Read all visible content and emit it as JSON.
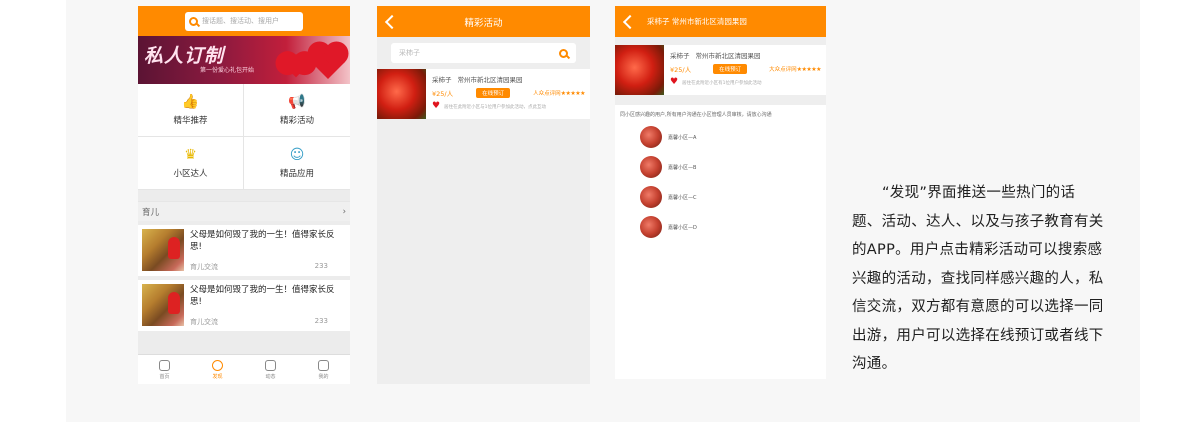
{
  "phone1": {
    "search_placeholder": "搜话题、搜活动、搜用户",
    "banner_title": "私人订制",
    "banner_subtitle": "第一份爱心礼包开始",
    "grid": [
      {
        "label": "精华推荐",
        "icon": "thumbs-up-icon",
        "glyph": "👍",
        "color": "#e0506a"
      },
      {
        "label": "精彩活动",
        "icon": "megaphone-icon",
        "glyph": "📢",
        "color": "#3aa98a"
      },
      {
        "label": "小区达人",
        "icon": "crown-icon",
        "glyph": "♛",
        "color": "#e8b800"
      },
      {
        "label": "精品应用",
        "icon": "app-face-icon",
        "glyph": "☺",
        "color": "#3aa0c8"
      }
    ],
    "section_title": "育儿",
    "posts": [
      {
        "title": "父母是如何毁了我的一生！值得家长反思!",
        "tag": "育儿交流",
        "count": "233"
      },
      {
        "title": "父母是如何毁了我的一生！值得家长反思!",
        "tag": "育儿交流",
        "count": "233"
      }
    ],
    "tabs": [
      {
        "label": "首页",
        "icon": "home-icon"
      },
      {
        "label": "发现",
        "icon": "discover-icon"
      },
      {
        "label": "动态",
        "icon": "feed-icon"
      },
      {
        "label": "我的",
        "icon": "profile-icon"
      }
    ]
  },
  "phone2": {
    "title": "精彩活动",
    "search_placeholder": "采柿子",
    "activity": {
      "name": "采柿子",
      "location": "常州市新北区清园果园",
      "price": "¥25/人",
      "book_label": "在线预订",
      "rating_label": "人众点评网",
      "stars": "★★★★★",
      "note": "居住在此附近小区与1位用户参加此活动，点此互动"
    }
  },
  "phone3": {
    "title": "采柿子   常州市新北区清园果园",
    "activity": {
      "name": "采柿子",
      "location": "常州市新北区清园果园",
      "price": "¥25/人",
      "book_label": "在线预订",
      "rating_label": "大众点评网",
      "stars": "★★★★★",
      "note": "居住在此附近小区有1位用户参加此活动"
    },
    "intro": "同小区感兴趣的用户,所有用户沟通在小区管理人员审核，请放心沟通",
    "members": [
      "嘉馨小区—A",
      "嘉馨小区—B",
      "嘉馨小区—C",
      "嘉馨小区—D"
    ]
  },
  "description": "“发现”界面推送一些热门的话题、活动、达人、以及与孩子教育有关的APP。用户点击精彩活动可以搜索感兴趣的活动，查找同样感兴趣的人，私信交流，双方都有意愿的可以选择一同出游，用户可以选择在线预订或者线下沟通。",
  "colors": {
    "accent": "#ff8a00",
    "background": "#f7f7f7"
  }
}
